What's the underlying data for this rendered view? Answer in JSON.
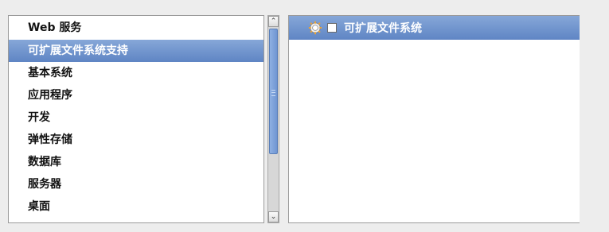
{
  "categories": [
    {
      "label": "Web 服务"
    },
    {
      "label": "可扩展文件系统支持"
    },
    {
      "label": "基本系统"
    },
    {
      "label": "应用程序"
    },
    {
      "label": "开发"
    },
    {
      "label": "弹性存储"
    },
    {
      "label": "数据库"
    },
    {
      "label": "服务器"
    },
    {
      "label": "桌面"
    }
  ],
  "selected_category_index": 1,
  "groups": [
    {
      "label": "可扩展文件系统",
      "checked": false,
      "icon": "gear-icon"
    }
  ],
  "scrollbar": {
    "up_glyph": "⌃",
    "down_glyph": "⌄"
  },
  "colors": {
    "selection": "#6f93cd",
    "background": "#ededed"
  }
}
